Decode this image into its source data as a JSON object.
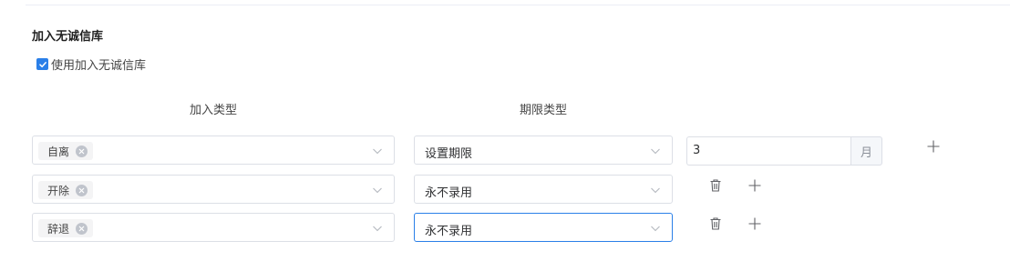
{
  "section": {
    "title": "加入无诚信库",
    "checkbox_label": "使用加入无诚信库",
    "checkbox_checked": true
  },
  "columns": {
    "join_type": "加入类型",
    "limit_type": "期限类型"
  },
  "rows": [
    {
      "tag": "自离",
      "limit": "设置期限",
      "duration_value": "3",
      "duration_unit": "月"
    },
    {
      "tag": "开除",
      "limit": "永不录用"
    },
    {
      "tag": "辞退",
      "limit": "永不录用"
    }
  ],
  "colors": {
    "accent": "#2a7fe8",
    "border": "#dcdfe6",
    "tag_bg": "#f4f4f5"
  },
  "icons": [
    "checkbox-check-icon",
    "tag-close-icon",
    "chevron-down-icon",
    "trash-icon",
    "plus-icon"
  ]
}
